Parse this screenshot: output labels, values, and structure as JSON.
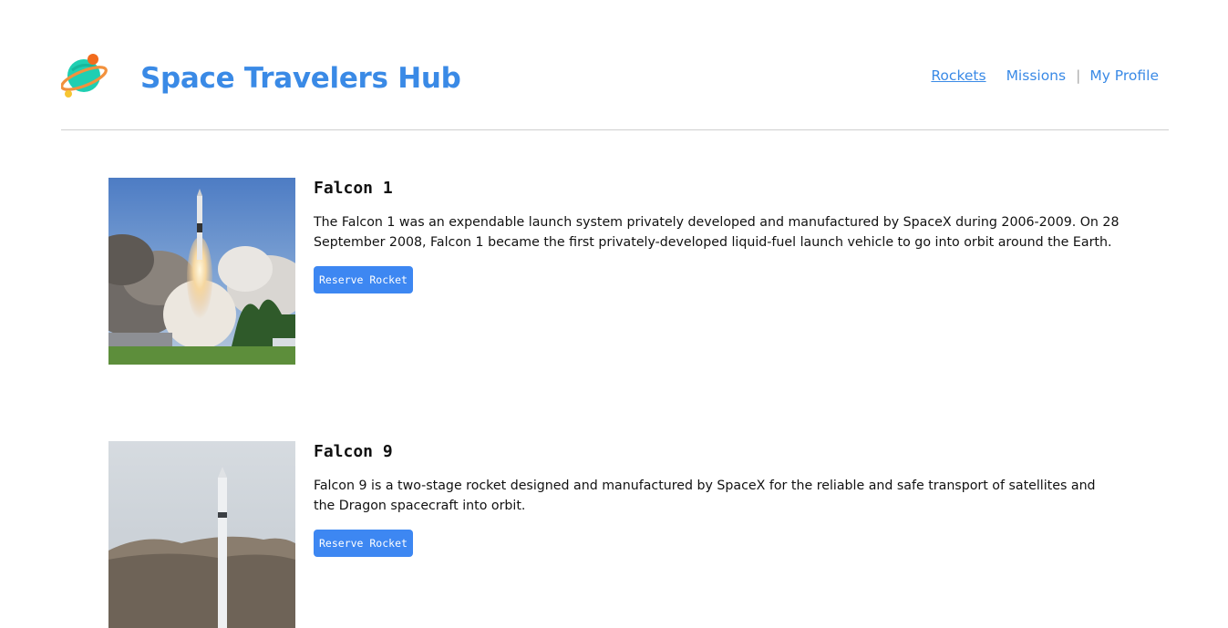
{
  "header": {
    "brand": "Space Travelers Hub",
    "logo_icon": "planet-logo-icon",
    "nav": [
      {
        "label": "Rockets",
        "active": true
      },
      {
        "label": "Missions",
        "active": false
      },
      {
        "label": "My Profile",
        "active": false
      }
    ],
    "nav_separator": "|"
  },
  "rockets": [
    {
      "name": "Falcon 1",
      "description": "The Falcon 1 was an expendable launch system privately developed and manufactured by SpaceX during 2006-2009. On 28 September 2008, Falcon 1 became the first privately-developed liquid-fuel launch vehicle to go into orbit around the Earth.",
      "button_label": "Reserve Rocket",
      "image_icon": "rocket-launch-photo"
    },
    {
      "name": "Falcon 9",
      "description": "Falcon 9 is a two-stage rocket designed and manufactured by SpaceX for the reliable and safe transport of satellites and the Dragon spacecraft into orbit.",
      "button_label": "Reserve Rocket",
      "image_icon": "rocket-on-pad-photo"
    }
  ],
  "colors": {
    "accent": "#3a8ae6",
    "button": "#3d87f2",
    "divider": "#cfcfcf"
  }
}
